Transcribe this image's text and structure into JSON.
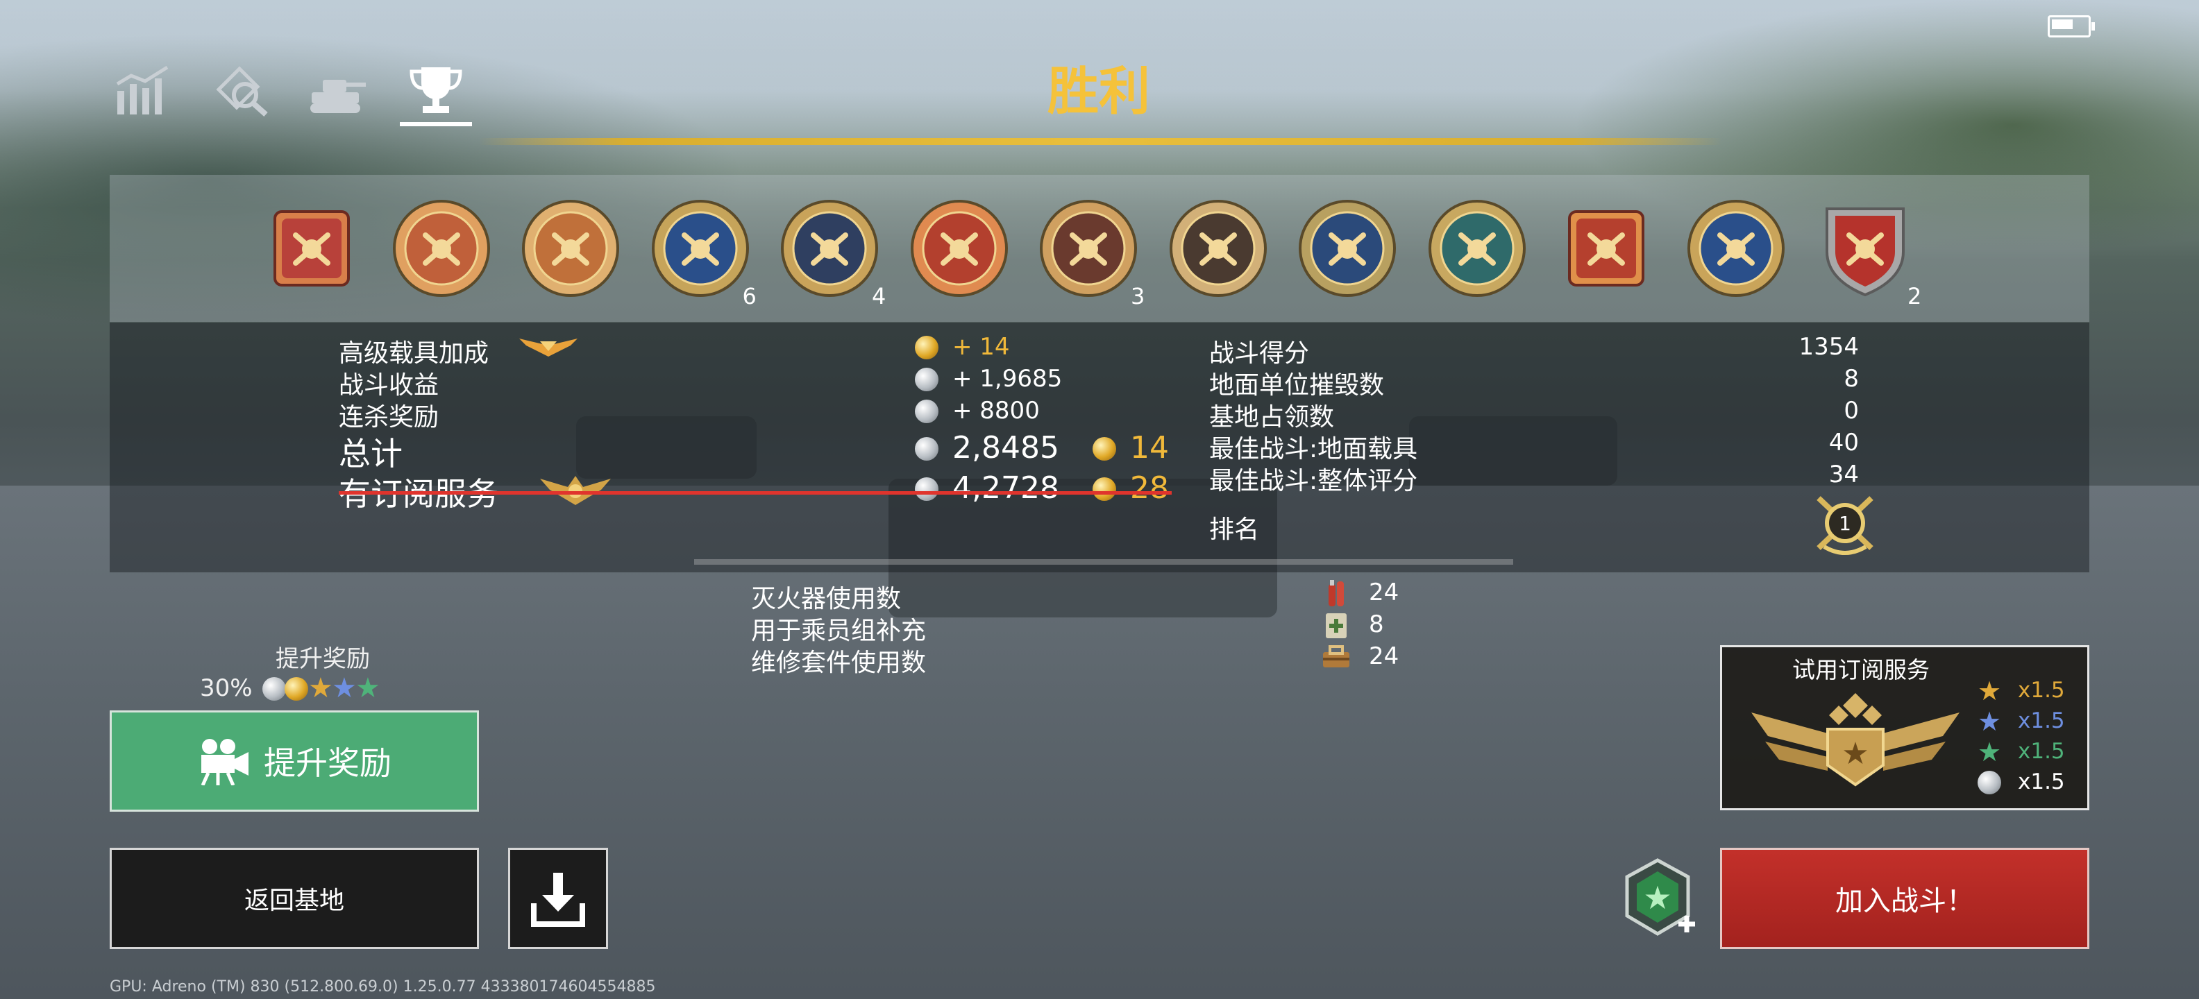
{
  "header": {
    "title": "胜利",
    "tabs": [
      {
        "name": "stats-icon"
      },
      {
        "name": "inspect-icon"
      },
      {
        "name": "tank-icon"
      },
      {
        "name": "trophy-icon",
        "active": true
      }
    ]
  },
  "medals": [
    {
      "icon": "medal-laurel",
      "count": ""
    },
    {
      "icon": "medal-axe",
      "count": ""
    },
    {
      "icon": "medal-tank",
      "count": ""
    },
    {
      "icon": "medal-grenade",
      "count": "6"
    },
    {
      "icon": "medal-dagger",
      "count": "4"
    },
    {
      "icon": "medal-vehicles",
      "count": ""
    },
    {
      "icon": "medal-crossed-swords",
      "count": "3"
    },
    {
      "icon": "medal-soldier",
      "count": ""
    },
    {
      "icon": "medal-stars",
      "count": ""
    },
    {
      "icon": "medal-armor",
      "count": ""
    },
    {
      "icon": "medal-letter-a",
      "count": ""
    },
    {
      "icon": "medal-fist",
      "count": ""
    },
    {
      "icon": "medal-shield-swords",
      "count": "2"
    }
  ],
  "rewards": {
    "premium_vehicle_bonus": {
      "label": "高级载具加成",
      "gold": "+ 14"
    },
    "battle_income": {
      "label": "战斗收益",
      "silver": "+ 1,9685"
    },
    "streak_bonus": {
      "label": "连杀奖励",
      "silver": "+ 8800"
    },
    "total": {
      "label": "总计",
      "silver": "2,8485",
      "gold": "14"
    },
    "subscription": {
      "label": "有订阅服务",
      "silver": "4,2728",
      "gold": "28"
    }
  },
  "battle_stats": {
    "rows": [
      {
        "label": "战斗得分",
        "value": "1354"
      },
      {
        "label": "地面单位摧毁数",
        "value": "8"
      },
      {
        "label": "基地占领数",
        "value": "0"
      },
      {
        "label": "最佳战斗:地面载具",
        "value": "40"
      },
      {
        "label": "最佳战斗:整体评分",
        "value": "34"
      }
    ],
    "rank_label": "排名",
    "rank_value": "1"
  },
  "consumables": [
    {
      "label": "灭火器使用数",
      "value": "24",
      "icon": "extinguisher-icon"
    },
    {
      "label": "用于乘员组补充",
      "value": "8",
      "icon": "first-aid-icon"
    },
    {
      "label": "维修套件使用数",
      "value": "24",
      "icon": "toolbox-icon"
    }
  ],
  "boost": {
    "title": "提升奖励",
    "percent": "30%",
    "button_label": "提升奖励"
  },
  "trial": {
    "title": "试用订阅服务",
    "multipliers": [
      {
        "icon": "gold-star",
        "value": "x1.5",
        "color": "#e0a93a"
      },
      {
        "icon": "blue-star",
        "value": "x1.5",
        "color": "#6e8fe0"
      },
      {
        "icon": "green-star",
        "value": "x1.5",
        "color": "#4fb37a"
      },
      {
        "icon": "silver-coin",
        "value": "x1.5",
        "color": "#c8cdd2"
      }
    ]
  },
  "buttons": {
    "return_base": "返回基地",
    "join_battle": "加入战斗！"
  },
  "gpu_info": "GPU: Adreno (TM) 830 (512.800.69.0)   1.25.0.77   433380174604554885",
  "colors": {
    "title_gold": "#f5c23a",
    "gold_value": "#f1b93a",
    "green_button": "#4cab75",
    "red_button": "#b52924",
    "strike": "#e0342d"
  }
}
